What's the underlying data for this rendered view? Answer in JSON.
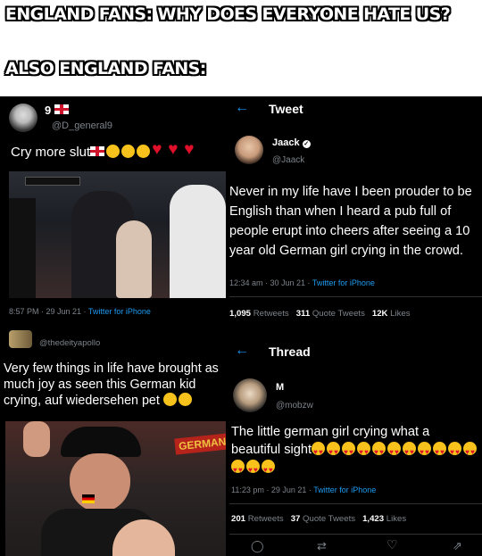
{
  "caption": {
    "line1": "ENGLAND FANS: WHY DOES EVERYONE HATE US?",
    "line2": "ALSO ENGLAND FANS:"
  },
  "tweet1": {
    "name": "9",
    "handle": "@D_general9",
    "text": "Cry more slut",
    "footer": "8:57 PM · 29 Jun 21 · ",
    "client": "Twitter for iPhone"
  },
  "tweet2": {
    "header": "Tweet",
    "name": "Jaack",
    "handle": "@Jaack",
    "text": "Never in my life have I been prouder to be English than when I heard a pub full of people erupt into cheers after seeing a 10 year old German girl crying in the crowd.",
    "footer": "12:34 am · 30 Jun 21 · ",
    "client": "Twitter for iPhone",
    "retweets": "1,095",
    "retweets_label": "Retweets",
    "quotes": "311",
    "quotes_label": "Quote Tweets",
    "likes": "12K",
    "likes_label": "Likes"
  },
  "tweet3": {
    "handle": "@thedeityapollo",
    "text": "Very few things in life have brought as much joy as seen this German kid crying, auf wiedersehen pet"
  },
  "tweet4": {
    "header": "Thread",
    "name": "M",
    "handle": "@mobzw",
    "text": "The little german girl crying what a beautiful sight",
    "footer": "11:23 pm · 29 Jun 21 · ",
    "client": "Twitter for iPhone",
    "retweets": "201",
    "retweets_label": "Retweets",
    "quotes": "37",
    "quotes_label": "Quote Tweets",
    "likes": "1,423",
    "likes_label": "Likes"
  },
  "photo1": {
    "banner": "GERMANY"
  },
  "colors": {
    "background": "#000000",
    "link": "#1d9bf0",
    "muted": "#7c838a"
  },
  "icons": [
    "back-arrow-icon",
    "verified-icon",
    "reply-icon",
    "retweet-icon",
    "like-icon",
    "share-icon"
  ]
}
